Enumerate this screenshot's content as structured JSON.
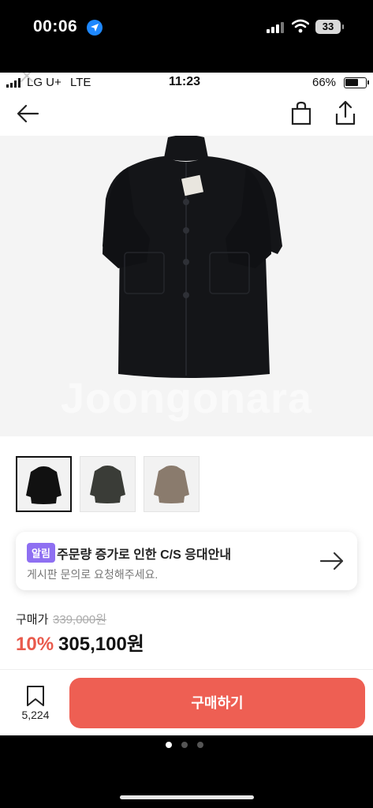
{
  "outer_status": {
    "time": "00:06",
    "battery": "33"
  },
  "inner_status": {
    "carrier": "LG U+",
    "network": "LTE",
    "time": "11:23",
    "battery_pct": "66%"
  },
  "hero": {
    "watermark": "Joongonara"
  },
  "thumbnails": [
    {
      "color": "#111111"
    },
    {
      "color": "#3a3c37"
    },
    {
      "color": "#8a7b6d"
    }
  ],
  "notice": {
    "badge": "알림",
    "title": "주문량 증가로 인한 C/S 응대안내",
    "subtitle": "게시판 문의로 요청해주세요."
  },
  "price": {
    "label": "구매가",
    "original": "339,000원",
    "discount": "10%",
    "final": "305,100원"
  },
  "wishlist": {
    "count": "5,224"
  },
  "buy_button": {
    "label": "구매하기"
  },
  "colors": {
    "accent": "#ee5f53",
    "discount": "#e95a4c",
    "badge": "#8e6ff2"
  },
  "pager": {
    "pages": 3,
    "current": 1
  }
}
